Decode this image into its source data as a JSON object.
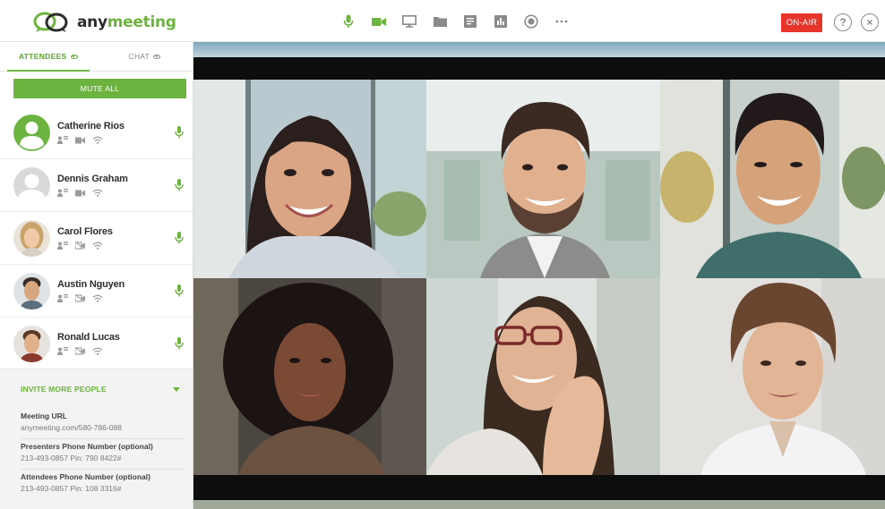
{
  "brand": {
    "name_part1": "any",
    "name_part2": "meeting",
    "accent": "#6cb33f"
  },
  "toolbar": {
    "items": [
      {
        "icon": "microphone-icon",
        "color": "#6cb33f"
      },
      {
        "icon": "video-camera-icon",
        "color": "#6cb33f"
      },
      {
        "icon": "screen-share-icon",
        "color": "#8a8a8a"
      },
      {
        "icon": "folder-icon",
        "color": "#8a8a8a"
      },
      {
        "icon": "notes-icon",
        "color": "#8a8a8a"
      },
      {
        "icon": "poll-chart-icon",
        "color": "#8a8a8a"
      },
      {
        "icon": "record-icon",
        "color": "#8a8a8a"
      },
      {
        "icon": "more-icon",
        "color": "#8a8a8a"
      }
    ],
    "on_air_label": "ON-AIR",
    "on_air_color": "#e8352b",
    "help_label": "?",
    "close_label": "×"
  },
  "sidebar": {
    "tabs": [
      {
        "label": "ATTENDEES",
        "active": true
      },
      {
        "label": "CHAT",
        "active": false
      }
    ],
    "mute_all_label": "MUTE ALL",
    "attendees": [
      {
        "name": "Catherine Rios",
        "avatar": "generic-green"
      },
      {
        "name": "Dennis Graham",
        "avatar": "generic-gray"
      },
      {
        "name": "Carol Flores",
        "avatar": "photo"
      },
      {
        "name": "Austin Nguyen",
        "avatar": "photo"
      },
      {
        "name": "Ronald Lucas",
        "avatar": "photo"
      }
    ],
    "invite": {
      "header": "INVITE MORE PEOPLE",
      "fields": [
        {
          "label": "Meeting URL",
          "value": "anymeeting.com/580-786-088"
        },
        {
          "label": "Presenters Phone Number (optional)",
          "value": "213-493-0857 Pin: 790 8422#"
        },
        {
          "label": "Attendees Phone Number (optional)",
          "value": "213-493-0857 Pin: 108 3316#"
        }
      ]
    }
  }
}
